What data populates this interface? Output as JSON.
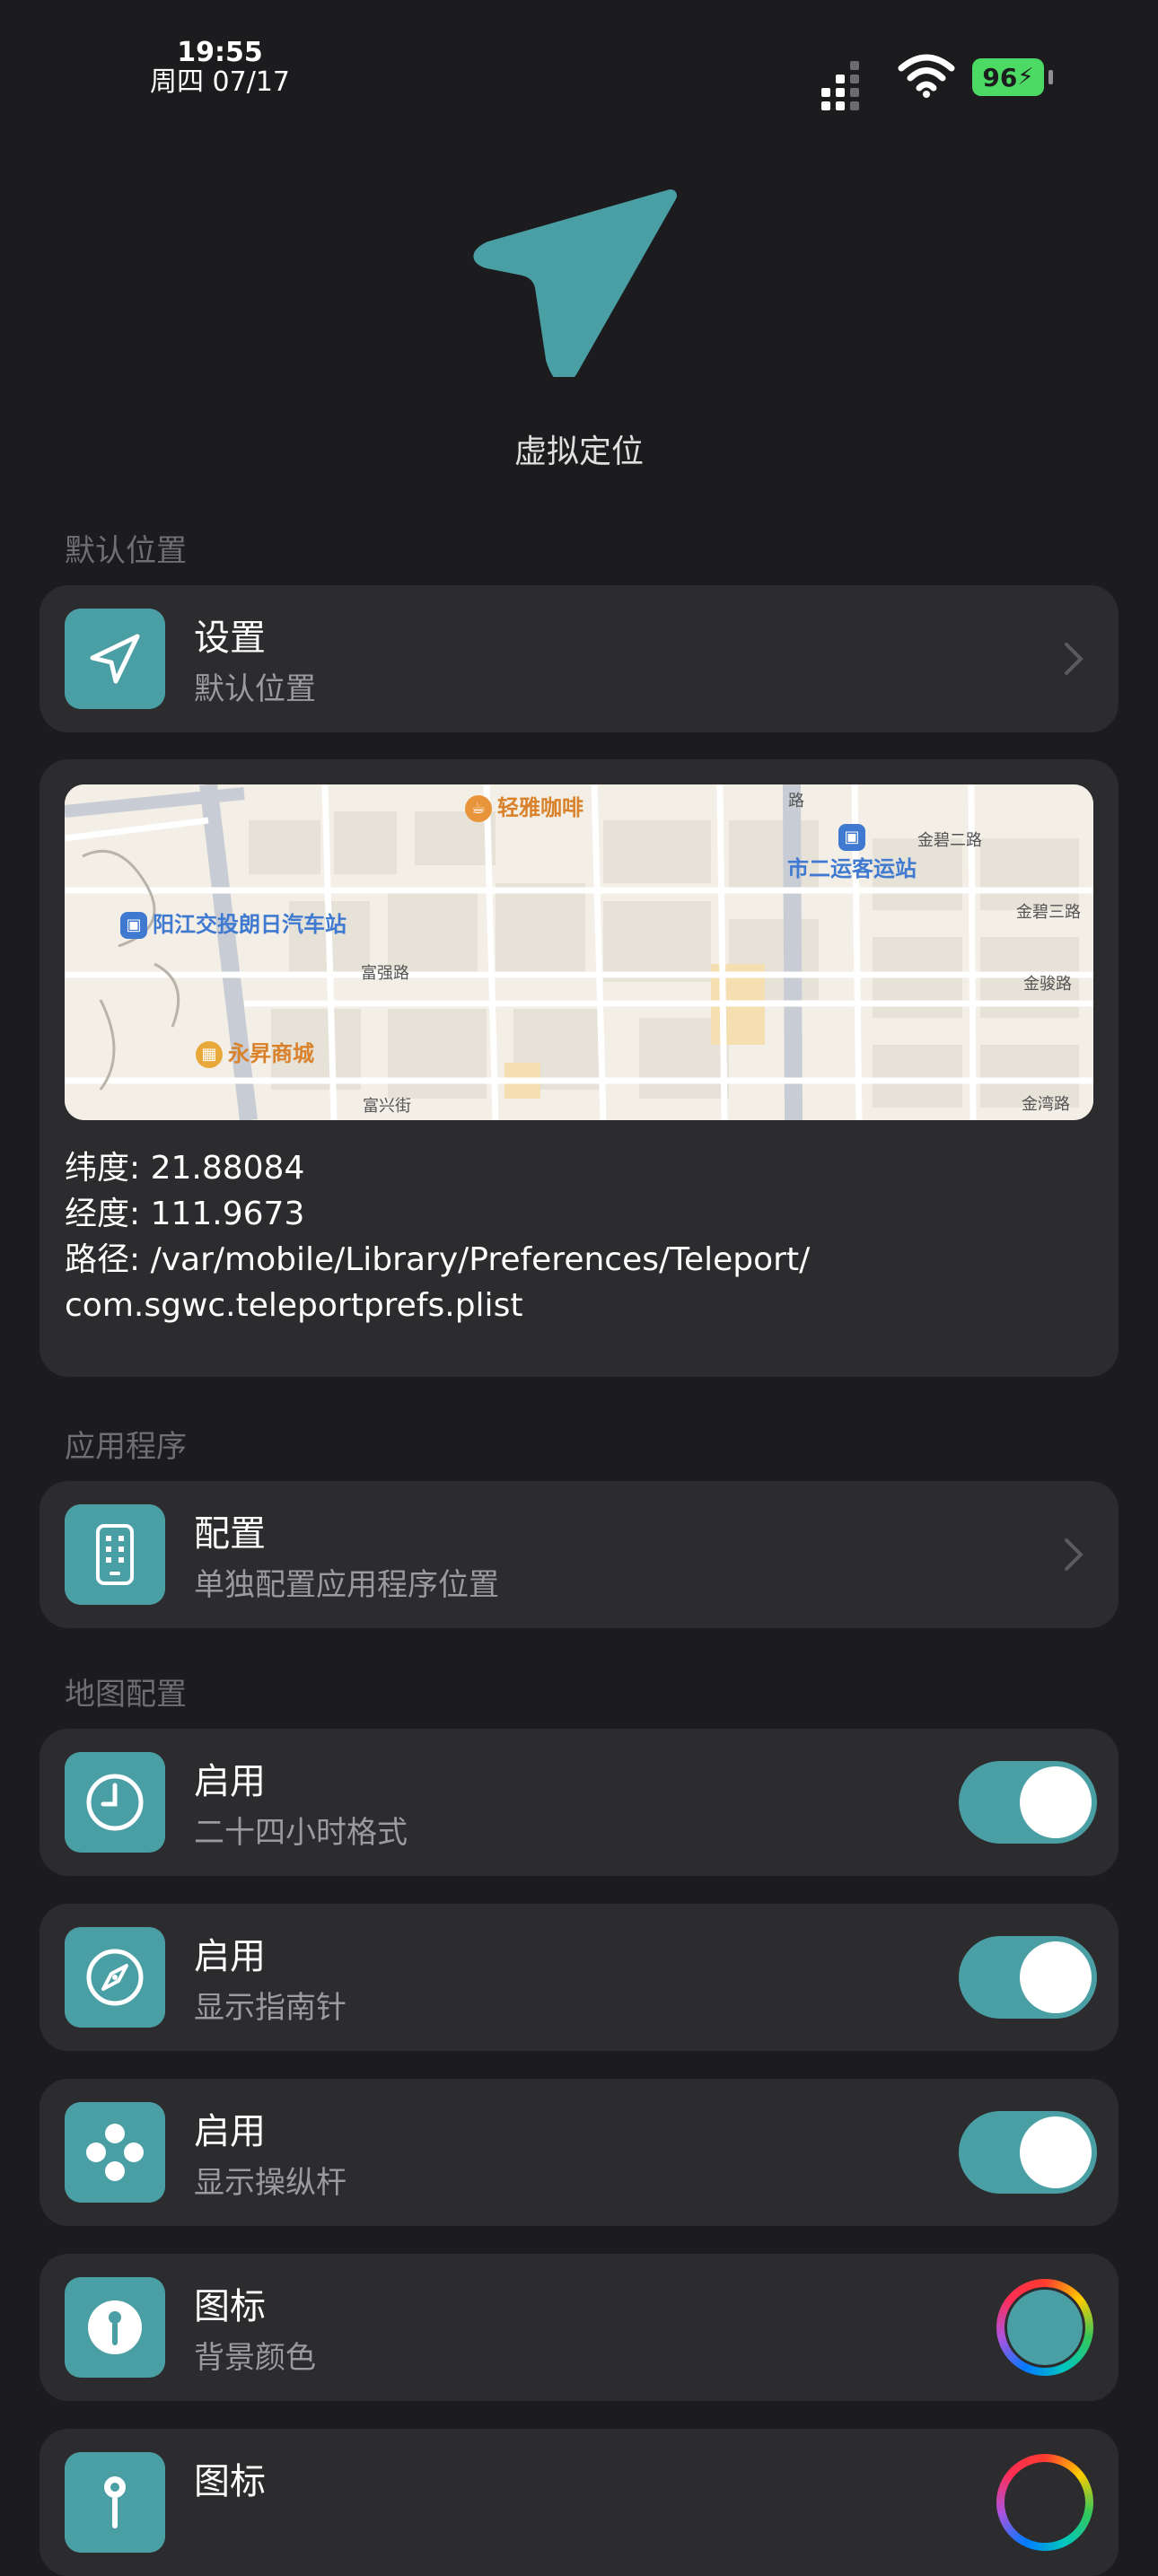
{
  "status_bar": {
    "time": "19:55",
    "date": "周四 07/17",
    "battery": "96"
  },
  "header": {
    "title": "虚拟定位"
  },
  "colors": {
    "accent": "#4a9fa4",
    "background": "#1c1c1e",
    "card": "#2c2c2e"
  },
  "sections": {
    "default_location": "默认位置",
    "applications": "应用程序",
    "map_config": "地图配置"
  },
  "settings_row": {
    "title": "设置",
    "subtitle": "默认位置",
    "icon": "location-arrow-icon"
  },
  "map": {
    "pois": [
      "轻雅咖啡",
      "市二运客运站",
      "阳江交投朗日汽车站",
      "永昇商城"
    ],
    "roads": [
      "金碧二路",
      "金碧三路",
      "金骏路",
      "金湾路",
      "富强路",
      "富兴街",
      "路"
    ]
  },
  "location_info": {
    "latitude_label": "纬度:",
    "latitude": "21.88084",
    "longitude_label": "经度:",
    "longitude": "111.9673",
    "path_label": "路径:",
    "path_line1": "/var/mobile/Library/Preferences/Teleport/",
    "path_line2": "com.sgwc.teleportprefs.plist"
  },
  "apps_row": {
    "title": "配置",
    "subtitle": "单独配置应用程序位置",
    "icon": "phone-icon"
  },
  "map_config_rows": [
    {
      "title": "启用",
      "subtitle": "二十四小时格式",
      "icon": "clock-icon",
      "enabled": true
    },
    {
      "title": "启用",
      "subtitle": "显示指南针",
      "icon": "compass-icon",
      "enabled": true
    },
    {
      "title": "启用",
      "subtitle": "显示操纵杆",
      "icon": "gamepad-icon",
      "enabled": true
    },
    {
      "title": "图标",
      "subtitle": "背景颜色",
      "icon": "pin-icon"
    },
    {
      "title": "图标",
      "subtitle": "",
      "icon": "pushpin-icon"
    }
  ]
}
